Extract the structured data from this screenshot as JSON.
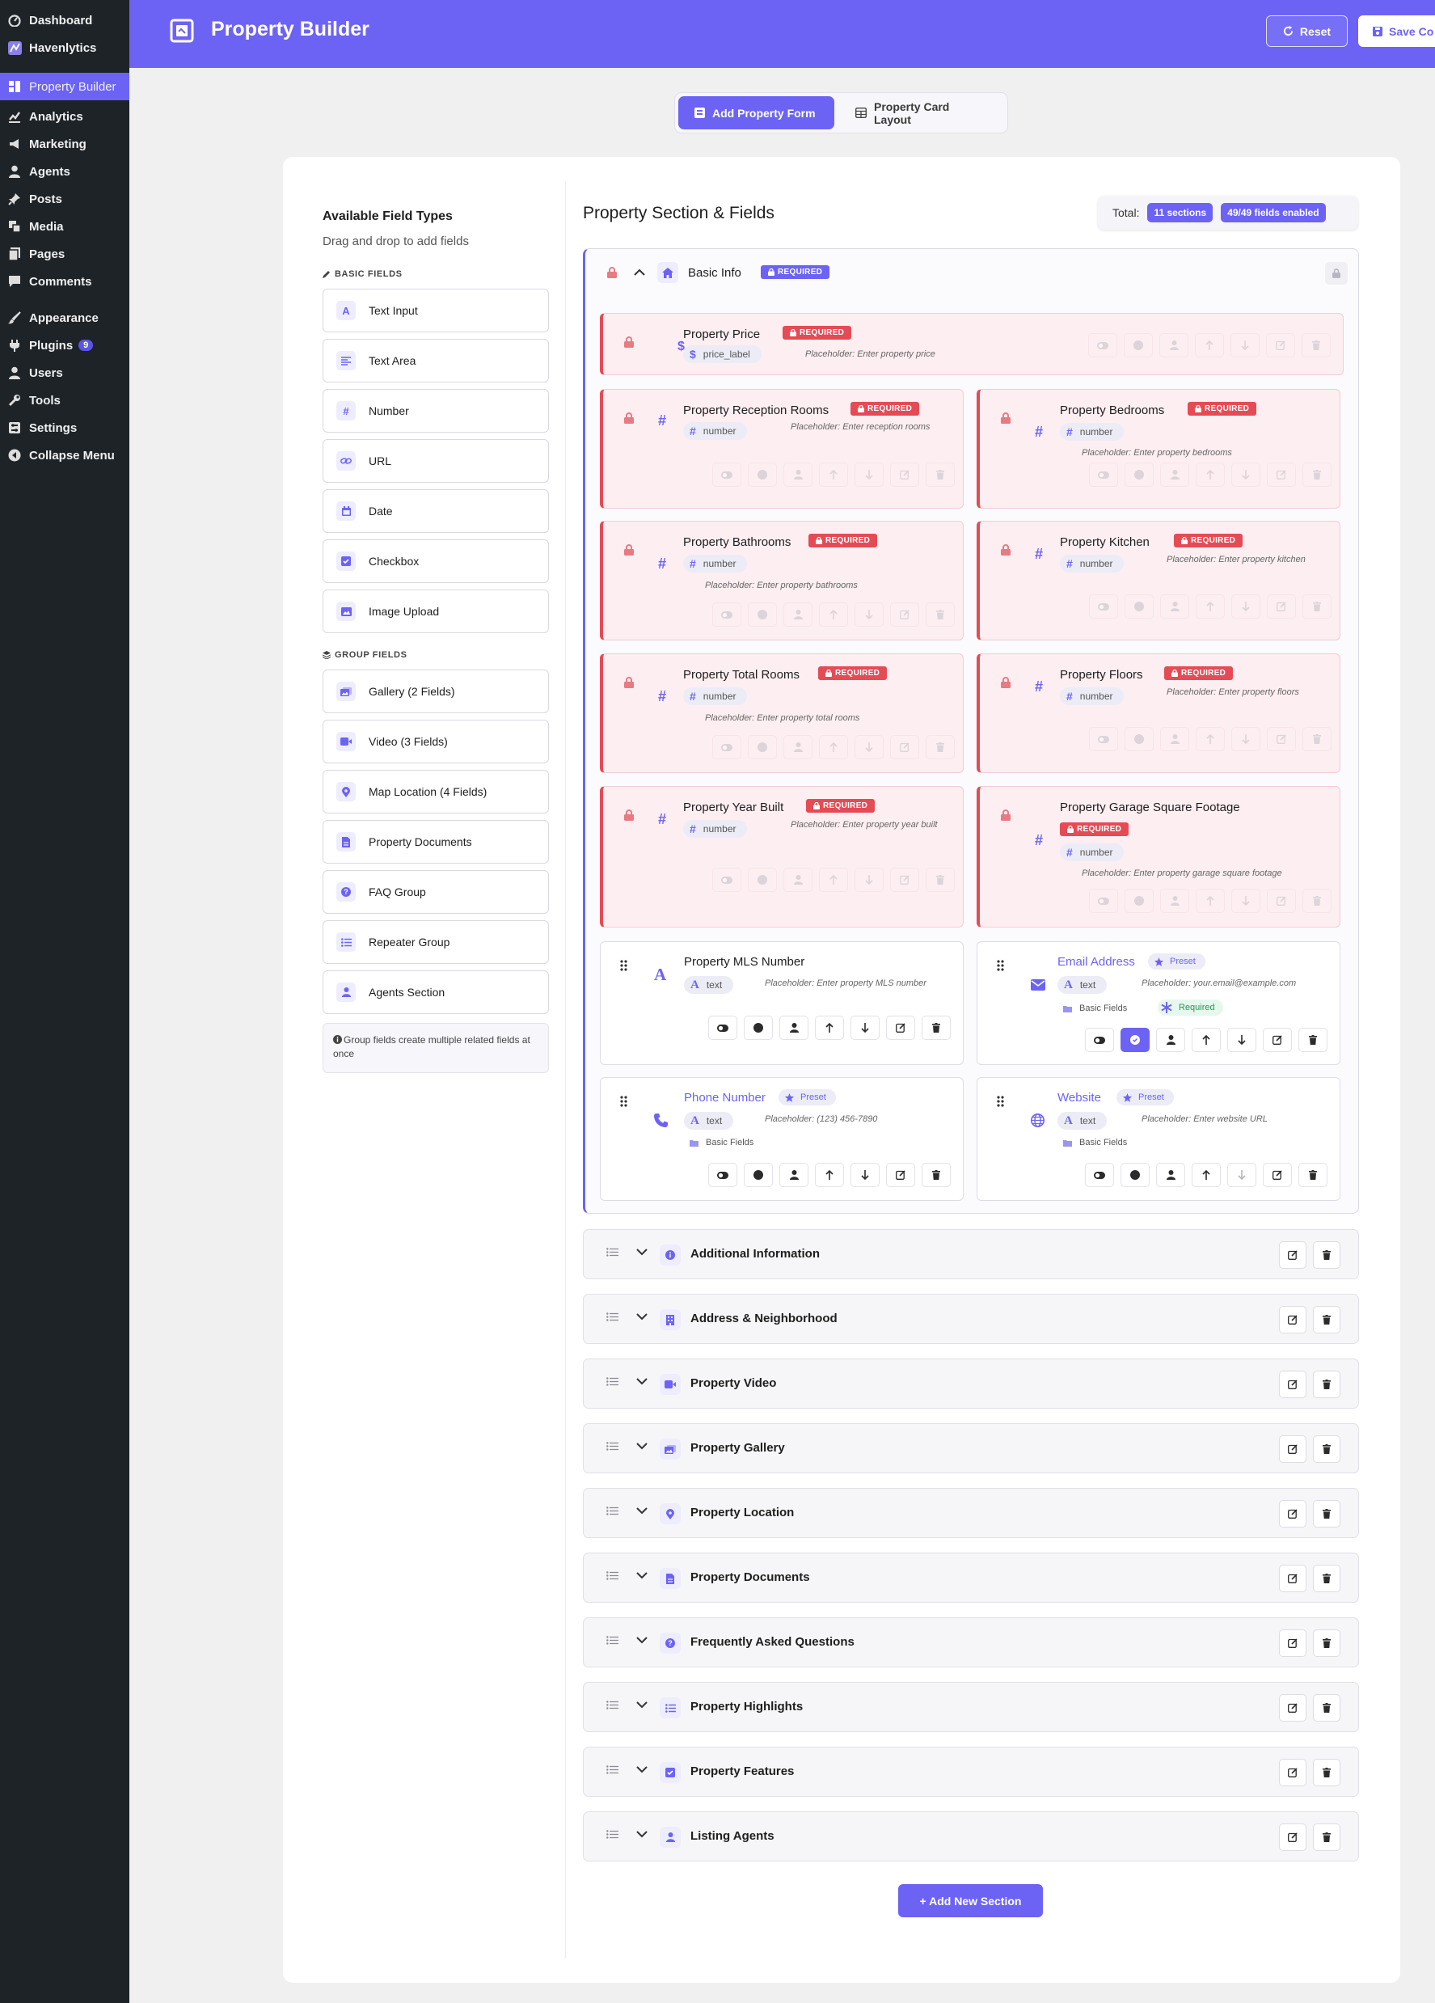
{
  "sidebar": {
    "items": [
      {
        "label": "Dashboard",
        "icon": "dashboard-icon"
      },
      {
        "label": "Havenlytics",
        "icon": "havenlytics-icon"
      },
      {
        "label": "Property Builder",
        "icon": "property-builder-icon",
        "active": true
      },
      {
        "label": "Analytics",
        "icon": "analytics-icon"
      },
      {
        "label": "Marketing",
        "icon": "megaphone-icon"
      },
      {
        "label": "Agents",
        "icon": "user-icon"
      },
      {
        "label": "Posts",
        "icon": "pin-icon"
      },
      {
        "label": "Media",
        "icon": "media-icon"
      },
      {
        "label": "Pages",
        "icon": "page-icon"
      },
      {
        "label": "Comments",
        "icon": "comment-icon"
      },
      {
        "label": "Appearance",
        "icon": "brush-icon"
      },
      {
        "label": "Plugins",
        "icon": "plugin-icon",
        "badge": "9"
      },
      {
        "label": "Users",
        "icon": "users-icon"
      },
      {
        "label": "Tools",
        "icon": "wrench-icon"
      },
      {
        "label": "Settings",
        "icon": "settings-icon"
      },
      {
        "label": "Collapse Menu",
        "icon": "collapse-icon"
      }
    ]
  },
  "header": {
    "title": "Property Builder",
    "reset_label": "Reset",
    "save_label": "Save Co"
  },
  "tabs": {
    "add_form": "Add Property Form",
    "card_layout": "Property Card Layout"
  },
  "left_panel": {
    "title": "Available Field Types",
    "subtitle": "Drag and drop to add fields",
    "basic_label": "BASIC FIELDS",
    "basic_fields": [
      "Text Input",
      "Text Area",
      "Number",
      "URL",
      "Date",
      "Checkbox",
      "Image Upload"
    ],
    "group_label": "GROUP FIELDS",
    "group_fields": [
      "Gallery (2 Fields)",
      "Video (3 Fields)",
      "Map Location (4 Fields)",
      "Property Documents",
      "FAQ Group",
      "Repeater Group",
      "Agents Section"
    ],
    "group_note": "Group fields create multiple related fields at once"
  },
  "right_panel": {
    "title": "Property Section & Fields",
    "total_label": "Total:",
    "sections_badge": "11 sections",
    "fields_badge": "49/49 fields enabled"
  },
  "basic_section": {
    "title": "Basic Info",
    "badge": "REQUIRED",
    "fields": [
      {
        "name": "Property Price",
        "type": "price_label",
        "placeholder": "Placeholder: Enter property price",
        "badge": "REQUIRED"
      },
      {
        "name": "Property Reception Rooms",
        "type": "number",
        "placeholder": "Placeholder: Enter reception rooms",
        "badge": "REQUIRED"
      },
      {
        "name": "Property Bedrooms",
        "type": "number",
        "placeholder": "Placeholder: Enter property bedrooms",
        "badge": "REQUIRED"
      },
      {
        "name": "Property Bathrooms",
        "type": "number",
        "placeholder": "Placeholder: Enter property bathrooms",
        "badge": "REQUIRED"
      },
      {
        "name": "Property Kitchen",
        "type": "number",
        "placeholder": "Placeholder: Enter property kitchen",
        "badge": "REQUIRED"
      },
      {
        "name": "Property Total Rooms",
        "type": "number",
        "placeholder": "Placeholder: Enter property total rooms",
        "badge": "REQUIRED"
      },
      {
        "name": "Property Floors",
        "type": "number",
        "placeholder": "Placeholder: Enter property floors",
        "badge": "REQUIRED"
      },
      {
        "name": "Property Year Built",
        "type": "number",
        "placeholder": "Placeholder: Enter property year built",
        "badge": "REQUIRED"
      },
      {
        "name": "Property Garage Square Footage",
        "type": "number",
        "placeholder": "Placeholder: Enter property garage square footage",
        "badge": "REQUIRED"
      },
      {
        "name": "Property MLS Number",
        "type": "text",
        "placeholder": "Placeholder: Enter property MLS number"
      },
      {
        "name": "Email Address",
        "type": "text",
        "placeholder": "Placeholder: your.email@example.com",
        "preset": "Preset",
        "category": "Basic Fields",
        "required_tag": "Required"
      },
      {
        "name": "Phone Number",
        "type": "text",
        "placeholder": "Placeholder: (123) 456-7890",
        "preset": "Preset",
        "category": "Basic Fields"
      },
      {
        "name": "Website",
        "type": "text",
        "placeholder": "Placeholder: Enter website URL",
        "preset": "Preset",
        "category": "Basic Fields"
      }
    ]
  },
  "sections": [
    {
      "title": "Additional Information",
      "icon": "info-icon"
    },
    {
      "title": "Address & Neighborhood",
      "icon": "building-icon"
    },
    {
      "title": "Property Video",
      "icon": "video-icon"
    },
    {
      "title": "Property Gallery",
      "icon": "gallery-icon"
    },
    {
      "title": "Property Location",
      "icon": "map-pin-icon"
    },
    {
      "title": "Property Documents",
      "icon": "document-icon"
    },
    {
      "title": "Frequently Asked Questions",
      "icon": "question-icon"
    },
    {
      "title": "Property Highlights",
      "icon": "list-icon"
    },
    {
      "title": "Property Features",
      "icon": "checkbox-icon"
    },
    {
      "title": "Listing Agents",
      "icon": "agent-icon"
    }
  ],
  "add_section_label": "+ Add New Section",
  "colors": {
    "accent": "#6c63f5",
    "required": "#e54b55",
    "sidebar": "#1d2327"
  }
}
